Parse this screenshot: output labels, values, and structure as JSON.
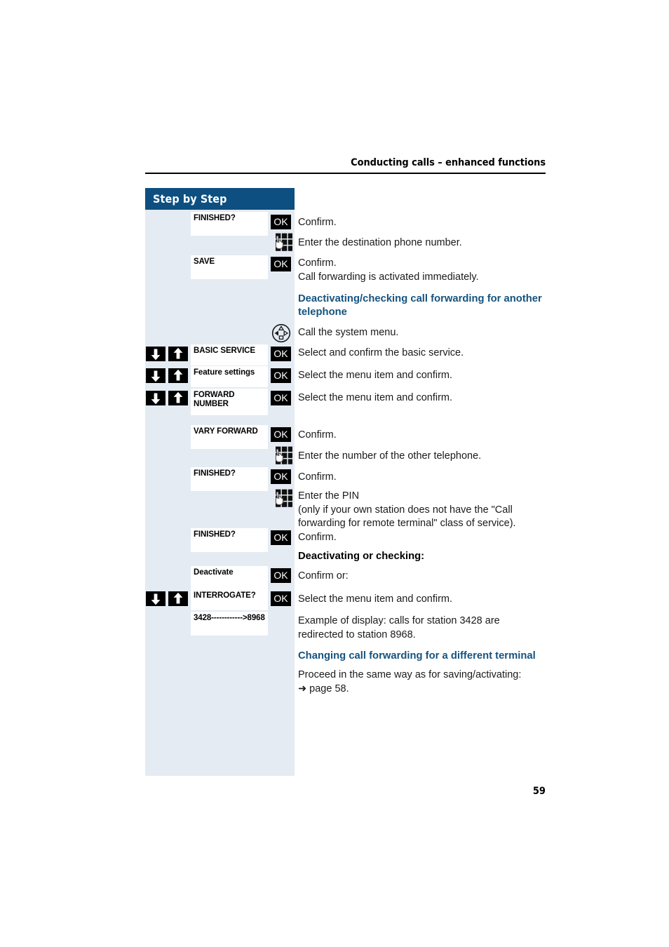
{
  "page": {
    "running_head": "Conducting calls – enhanced functions",
    "number": "59"
  },
  "sidebar": {
    "title": "Step by Step"
  },
  "keys": {
    "ok_label": "OK",
    "arrow_down_icon": "arrow-down-icon",
    "arrow_up_icon": "arrow-up-icon",
    "keypad_icon": "keypad-icon",
    "navigator_icon": "navigator-icon"
  },
  "rows": [
    {
      "id": "finished-confirm-1",
      "display": "FINISHED?",
      "key": "ok",
      "arrows": false,
      "text": "Confirm."
    },
    {
      "id": "enter-destination-number",
      "display": null,
      "key": "keypad",
      "arrows": false,
      "text": "Enter the destination phone number."
    },
    {
      "id": "save-confirm",
      "display": "SAVE",
      "key": "ok",
      "arrows": false,
      "text": "Confirm.\nCall forwarding is activated immediately."
    },
    {
      "id": "heading-deactivating-checking",
      "display": null,
      "key": null,
      "arrows": false,
      "text": "Deactivating/checking call forwarding for another telephone",
      "style": "heading-blue"
    },
    {
      "id": "call-system-menu",
      "display": null,
      "key": "navigator",
      "arrows": false,
      "text": "Call the system menu."
    },
    {
      "id": "basic-service",
      "display": "BASIC SERVICE",
      "key": "ok",
      "arrows": true,
      "text": "Select and confirm the basic service."
    },
    {
      "id": "feature-settings",
      "display": "Feature settings",
      "key": "ok",
      "arrows": true,
      "text": "Select the menu item and confirm."
    },
    {
      "id": "forward-number",
      "display": "FORWARD\nNUMBER",
      "key": "ok",
      "arrows": true,
      "text": "Select the menu item and confirm."
    },
    {
      "id": "vary-forward",
      "display": "VARY FORWARD",
      "key": "ok",
      "arrows": false,
      "text": "Confirm."
    },
    {
      "id": "enter-other-telephone-number",
      "display": null,
      "key": "keypad",
      "arrows": false,
      "text": "Enter the number of the other telephone."
    },
    {
      "id": "finished-confirm-2",
      "display": "FINISHED?",
      "key": "ok",
      "arrows": false,
      "text": "Confirm."
    },
    {
      "id": "enter-pin",
      "display": null,
      "key": "keypad",
      "arrows": false,
      "text": "Enter the PIN\n(only if your own station does not have the \"Call forwarding for remote terminal\" class of service)."
    },
    {
      "id": "finished-confirm-3",
      "display": "FINISHED?",
      "key": "ok",
      "arrows": false,
      "text": "Confirm."
    },
    {
      "id": "heading-deactivating-or-checking",
      "display": null,
      "key": null,
      "arrows": false,
      "text": "Deactivating or checking:",
      "style": "heading-black"
    },
    {
      "id": "deactivate",
      "display": "Deactivate",
      "key": "ok",
      "arrows": false,
      "text": "Confirm or:"
    },
    {
      "id": "interrogate",
      "display": "INTERROGATE?",
      "key": "ok",
      "arrows": true,
      "text": "Select the menu item and confirm."
    },
    {
      "id": "display-example",
      "display": "3428------------>8968",
      "key": null,
      "arrows": false,
      "text": "Example of display: calls for station 3428 are redirected to station 8968."
    },
    {
      "id": "heading-changing-call-forwarding",
      "display": null,
      "key": null,
      "arrows": false,
      "text": "Changing call forwarding for a different terminal",
      "style": "heading-blue"
    },
    {
      "id": "proceed-same-way",
      "display": null,
      "key": null,
      "arrows": false,
      "text": "Proceed in the same way as for saving/activating:\n➜ page 58."
    }
  ]
}
